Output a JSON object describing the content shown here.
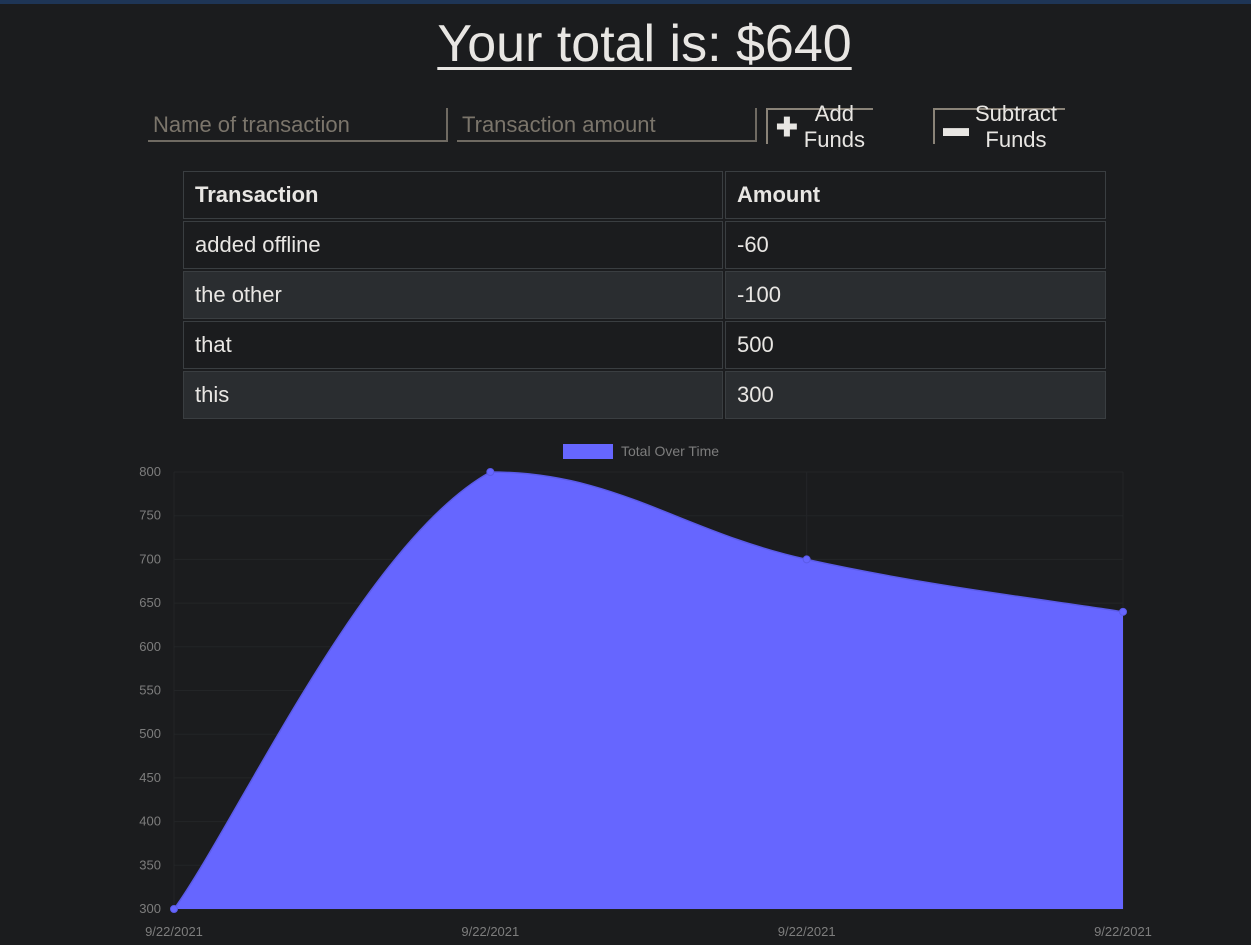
{
  "header": {
    "total_text": "Your total is: $640"
  },
  "form": {
    "name_placeholder": "Name of transaction",
    "name_value": "",
    "amount_placeholder": "Transaction amount",
    "amount_value": "",
    "add_label": "Add Funds",
    "add_icon": "plus-icon",
    "subtract_label": "Subtract Funds",
    "subtract_icon": "minus-icon"
  },
  "table": {
    "headers": [
      "Transaction",
      "Amount"
    ],
    "rows": [
      {
        "name": "added offline",
        "amount": "-60"
      },
      {
        "name": "the other",
        "amount": "-100"
      },
      {
        "name": "that",
        "amount": "500"
      },
      {
        "name": "this",
        "amount": "300"
      }
    ]
  },
  "colors": {
    "background": "#1b1c1e",
    "accent_fill": "#6666ff",
    "text": "#e8e6e3"
  },
  "chart_data": {
    "type": "area",
    "title": "",
    "xlabel": "",
    "ylabel": "",
    "x": [
      "9/22/2021",
      "9/22/2021",
      "9/22/2021",
      "9/22/2021"
    ],
    "series": [
      {
        "name": "Total Over Time",
        "values": [
          300,
          800,
          700,
          640
        ],
        "color": "#6666ff"
      }
    ],
    "ylim": [
      300,
      800
    ],
    "yticks": [
      300,
      350,
      400,
      450,
      500,
      550,
      600,
      650,
      700,
      750,
      800
    ],
    "legend_position": "top-center",
    "grid": true
  }
}
